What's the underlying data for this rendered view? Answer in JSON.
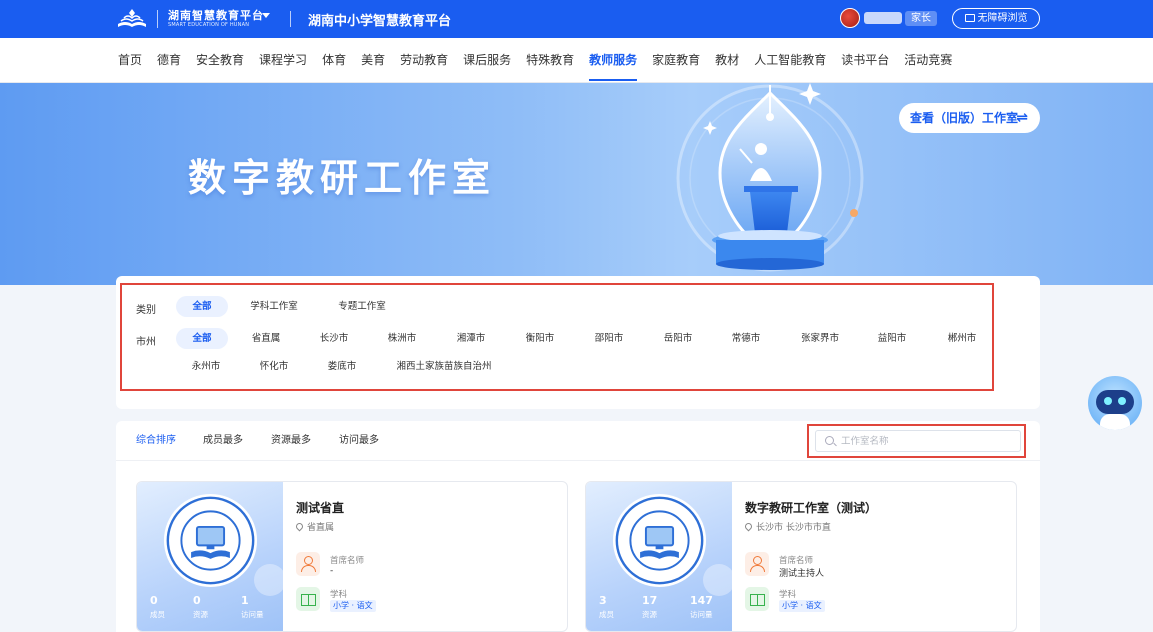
{
  "header": {
    "logo_title": "湖南智慧教育平台",
    "logo_subtitle": "SMART EDUCATION OF HUNAN",
    "platform_name": "湖南中小学智慧教育平台",
    "role": "家长",
    "accessibility_label": "无障碍浏览",
    "colors": {
      "primary": "#1a5df0",
      "highlight": "#e0453b"
    }
  },
  "nav": {
    "items": [
      "首页",
      "德育",
      "安全教育",
      "课程学习",
      "体育",
      "美育",
      "劳动教育",
      "课后服务",
      "特殊教育",
      "教师服务",
      "家庭教育",
      "教材",
      "人工智能教育",
      "读书平台",
      "活动竞赛"
    ],
    "active": "教师服务"
  },
  "banner": {
    "title": "数字教研工作室",
    "old_version_button": "查看（旧版）工作室",
    "swap_icon": "⇌"
  },
  "filters": {
    "category_label": "类别",
    "categories": [
      "全部",
      "学科工作室",
      "专题工作室"
    ],
    "city_label": "市州",
    "cities": [
      "全部",
      "省直属",
      "长沙市",
      "株洲市",
      "湘潭市",
      "衡阳市",
      "邵阳市",
      "岳阳市",
      "常德市",
      "张家界市",
      "益阳市",
      "郴州市",
      "永州市",
      "怀化市",
      "娄底市",
      "湘西土家族苗族自治州"
    ]
  },
  "sort": {
    "options": [
      "综合排序",
      "成员最多",
      "资源最多",
      "访问最多"
    ],
    "active": "综合排序",
    "search_placeholder": "工作室名称"
  },
  "cards": [
    {
      "title": "测试省直",
      "location": "省直属",
      "stats": [
        {
          "value": "0",
          "label": "成员"
        },
        {
          "value": "0",
          "label": "资源"
        },
        {
          "value": "1",
          "label": "访问量"
        }
      ],
      "chief_label": "首席名师",
      "chief_value": "-",
      "subject_label": "学科",
      "subject_value": "小学 · 语文"
    },
    {
      "title": "数字教研工作室（测试）",
      "location": "长沙市 长沙市市直",
      "stats": [
        {
          "value": "3",
          "label": "成员"
        },
        {
          "value": "17",
          "label": "资源"
        },
        {
          "value": "147",
          "label": "访问量"
        }
      ],
      "chief_label": "首席名师",
      "chief_value": "测试主持人",
      "subject_label": "学科",
      "subject_value": "小学 · 语文"
    }
  ]
}
